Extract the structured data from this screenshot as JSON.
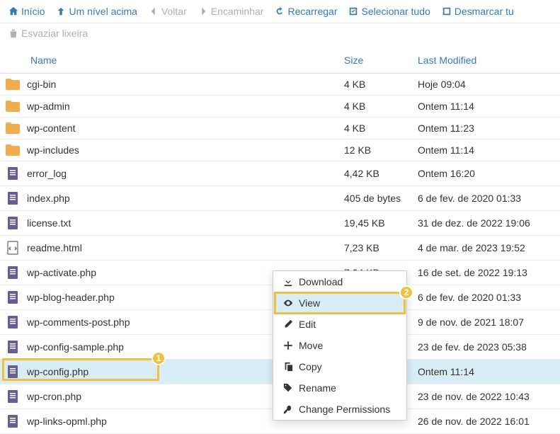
{
  "toolbar": {
    "home": "Início",
    "up": "Um nível acima",
    "back": "Voltar",
    "forward": "Encaminhar",
    "reload": "Recarregar",
    "selectAll": "Selecionar tudo",
    "unselect": "Desmarcar tu",
    "empty": "Esvaziar lixeira"
  },
  "headers": {
    "name": "Name",
    "size": "Size",
    "modified": "Last Modified"
  },
  "files": [
    {
      "name": "cgi-bin",
      "size": "4 KB",
      "modified": "Hoje 09:04",
      "type": "folder"
    },
    {
      "name": "wp-admin",
      "size": "4 KB",
      "modified": "Ontem 11:14",
      "type": "folder"
    },
    {
      "name": "wp-content",
      "size": "4 KB",
      "modified": "Ontem 11:23",
      "type": "folder"
    },
    {
      "name": "wp-includes",
      "size": "12 KB",
      "modified": "Ontem 11:14",
      "type": "folder"
    },
    {
      "name": "error_log",
      "size": "4,42 KB",
      "modified": "Ontem 16:20",
      "type": "file"
    },
    {
      "name": "index.php",
      "size": "405 de bytes",
      "modified": "6 de fev. de 2020 01:33",
      "type": "file"
    },
    {
      "name": "license.txt",
      "size": "19,45 KB",
      "modified": "31 de dez. de 2022 19:06",
      "type": "file"
    },
    {
      "name": "readme.html",
      "size": "7,23 KB",
      "modified": "4 de mar. de 2023 19:52",
      "type": "html"
    },
    {
      "name": "wp-activate.php",
      "size": "7,04 KB",
      "modified": "16 de set. de 2022 19:13",
      "type": "file"
    },
    {
      "name": "wp-blog-header.php",
      "size": "",
      "modified": "6 de fev. de 2020 01:33",
      "type": "file"
    },
    {
      "name": "wp-comments-post.php",
      "size": "",
      "modified": "9 de nov. de 2021 18:07",
      "type": "file"
    },
    {
      "name": "wp-config-sample.php",
      "size": "",
      "modified": "23 de fev. de 2023 05:38",
      "type": "file"
    },
    {
      "name": "wp-config.php",
      "size": "",
      "modified": "Ontem 11:14",
      "type": "file",
      "selected": true,
      "highlight": 1
    },
    {
      "name": "wp-cron.php",
      "size": "",
      "modified": "23 de nov. de 2022 10:43",
      "type": "file"
    },
    {
      "name": "wp-links-opml.php",
      "size": "",
      "modified": "26 de nov. de 2022 16:01",
      "type": "file"
    }
  ],
  "contextMenu": {
    "items": [
      {
        "label": "Download",
        "icon": "download"
      },
      {
        "label": "View",
        "icon": "eye",
        "hovered": true,
        "highlight": 2
      },
      {
        "label": "Edit",
        "icon": "pencil"
      },
      {
        "label": "Move",
        "icon": "move"
      },
      {
        "label": "Copy",
        "icon": "copy"
      },
      {
        "label": "Rename",
        "icon": "tag"
      },
      {
        "label": "Change Permissions",
        "icon": "key"
      }
    ]
  }
}
